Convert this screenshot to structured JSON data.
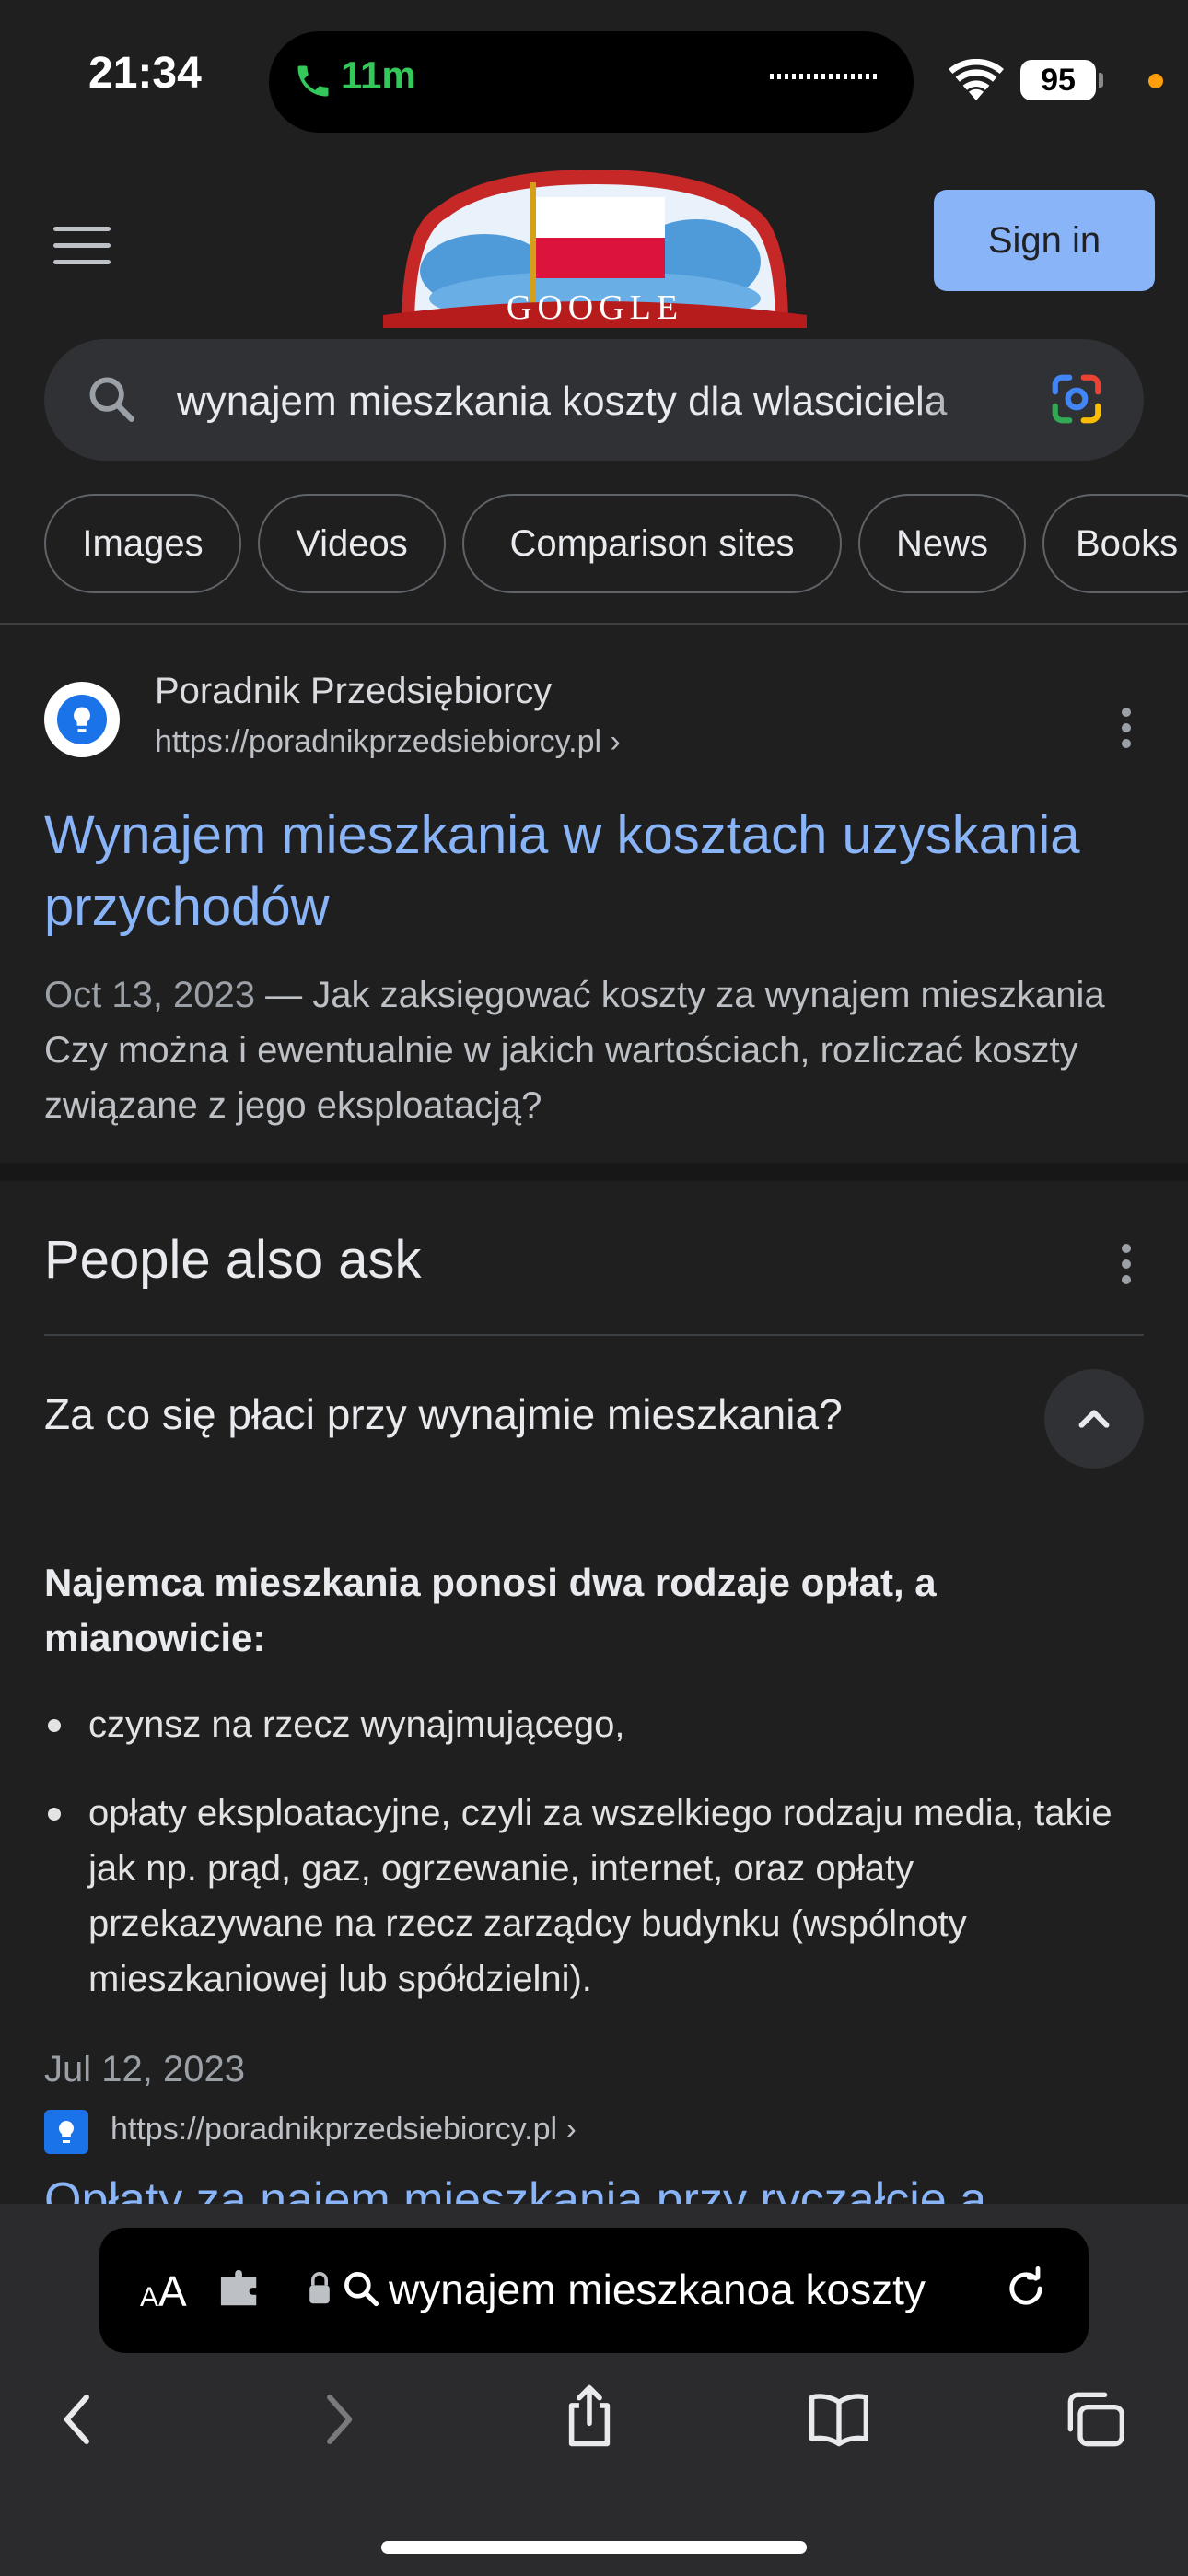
{
  "status_bar": {
    "time": "21:34",
    "call_duration": "11m",
    "battery": "95"
  },
  "header": {
    "doodle_text": "GOOGLE",
    "sign_in_label": "Sign in"
  },
  "search": {
    "query": "wynajem mieszkania koszty dla wlasciciela"
  },
  "chips": [
    "Images",
    "Videos",
    "Comparison sites",
    "News",
    "Books"
  ],
  "result": {
    "site_name": "Poradnik Przedsiębiorcy",
    "url": "https://poradnikprzedsiebiorcy.pl ›",
    "title": "Wynajem mieszkania w kosztach uzyskania przychodów",
    "date": "Oct 13, 2023",
    "dash": " — ",
    "snippet": "Jak zaksięgować koszty za wynajem mieszkania Czy można i ewentualnie w jakich wartościach, rozliczać koszty związane z jego eksploatacją?"
  },
  "paa": {
    "title": "People also ask",
    "question": "Za co się płaci przy wynajmie mieszkania?",
    "answer_bold": "Najemca mieszkania ponosi dwa rodzaje opłat, a mianowicie:",
    "bullets": [
      "czynsz na rzecz wynajmującego,",
      "opłaty eksploatacyjne, czyli za wszelkiego rodzaju media, takie jak np. prąd, gaz, ogrzewanie, internet, oraz opłaty przekazywane na rzecz zarządcy budynku (wspólnoty mieszkaniowej lub spółdzielni)."
    ],
    "date": "Jul 12, 2023",
    "source_url": "https://poradnikprzedsiebiorcy.pl ›",
    "next_link": "Opłaty za najem mieszkania przy ryczałcie a"
  },
  "browser": {
    "aa_label_small": "A",
    "aa_label_big": "A",
    "address_text": "wynajem mieszkanoa koszty"
  },
  "colors": {
    "link": "#8ab4f8",
    "background": "#1f1f1f",
    "sign_in_bg": "#8ab4f8",
    "call_green": "#34c759"
  }
}
